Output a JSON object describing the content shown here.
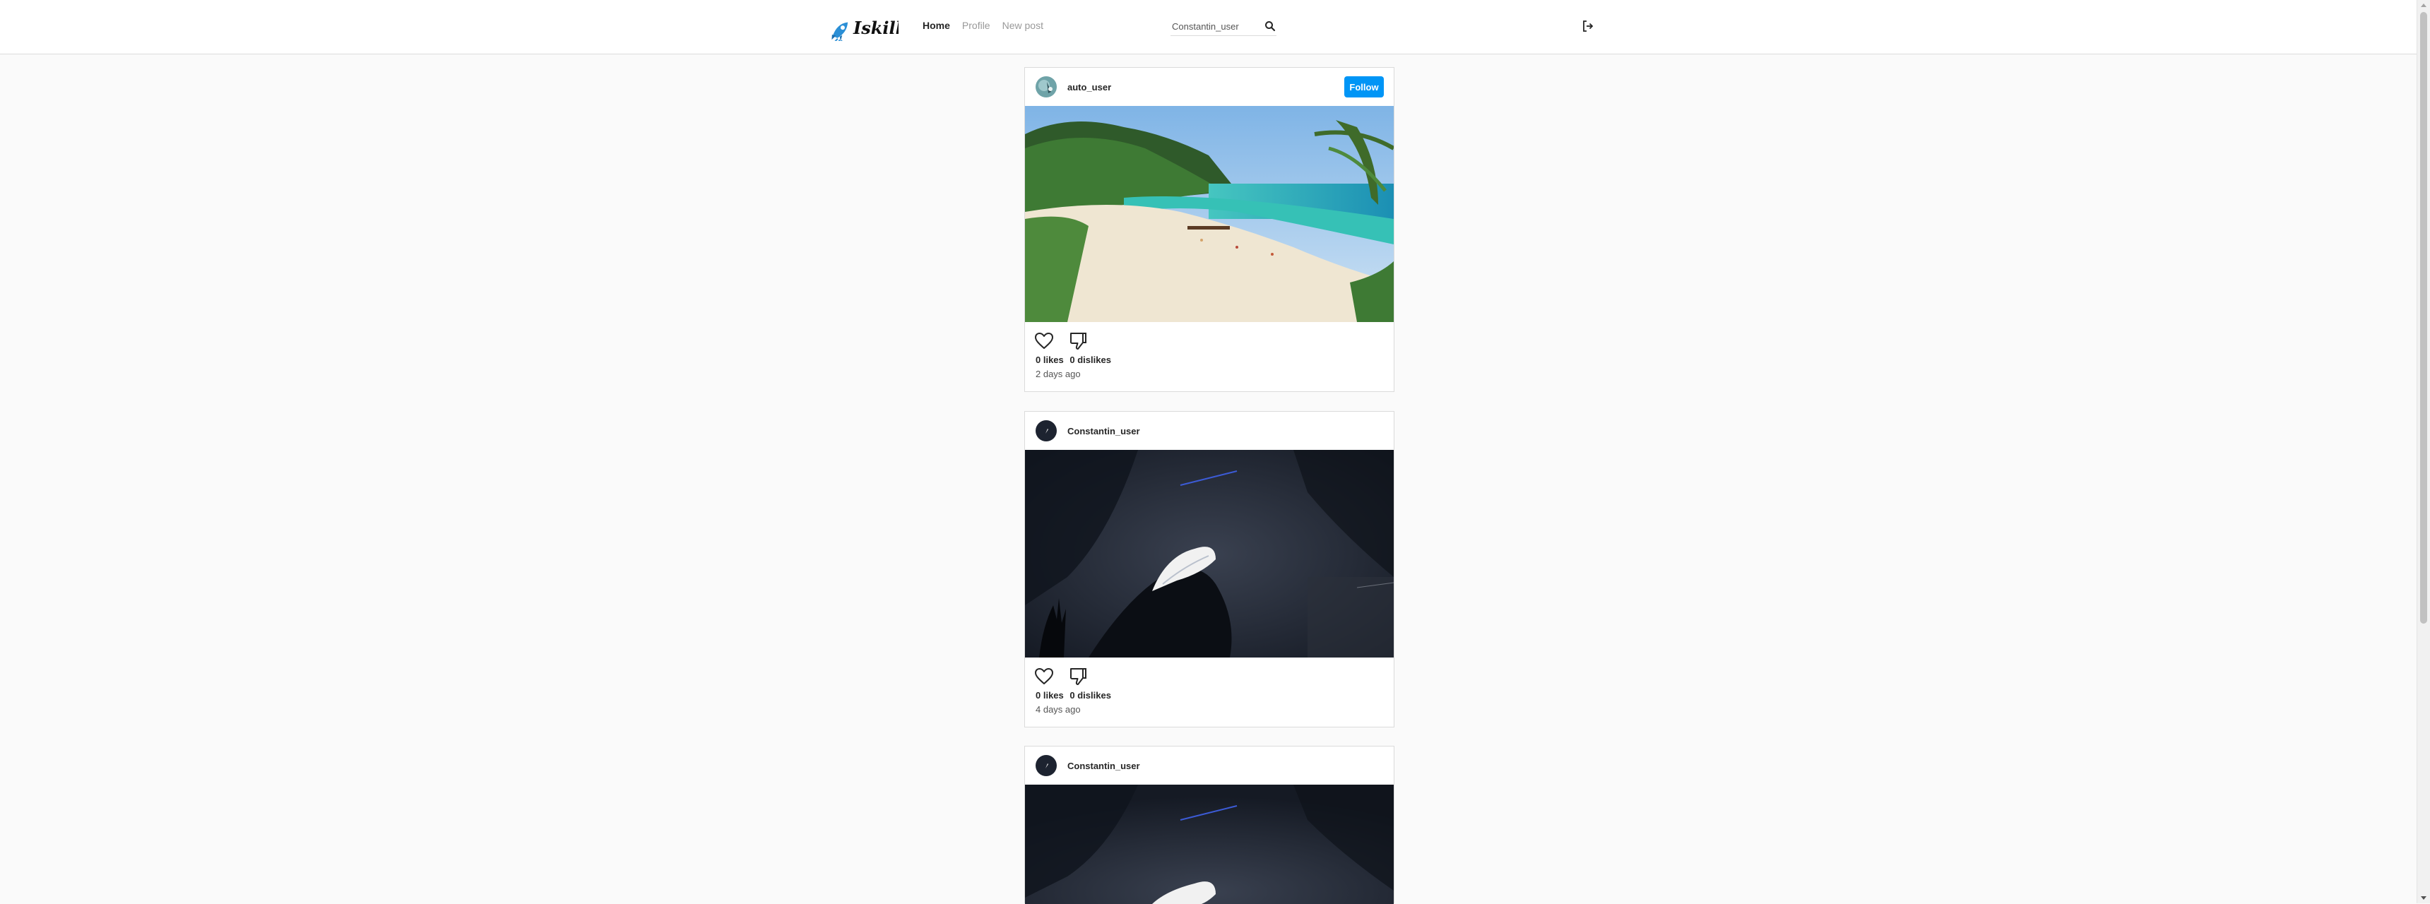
{
  "header": {
    "logo_text": "Iskillo",
    "nav": [
      {
        "label": "Home",
        "active": true
      },
      {
        "label": "Profile",
        "active": false
      },
      {
        "label": "New post",
        "active": false
      }
    ],
    "search": {
      "value": "",
      "placeholder": "Constantin_user"
    },
    "icons": {
      "search": "search-icon",
      "logout": "logout-icon"
    }
  },
  "posts": [
    {
      "username": "auto_user",
      "follow_label": "Follow",
      "image": "beach-photo",
      "likes_text": "0 likes",
      "dislikes_text": "0 dislikes",
      "time_text": "2 days ago"
    },
    {
      "username": "Constantin_user",
      "image": "dark-art-photo",
      "likes_text": "0 likes",
      "dislikes_text": "0 dislikes",
      "time_text": "4 days ago"
    },
    {
      "username": "Constantin_user",
      "image": "dark-art-photo"
    }
  ],
  "colors": {
    "accent": "#0095f6",
    "background": "#fafafa",
    "border": "#dbdbdb"
  }
}
